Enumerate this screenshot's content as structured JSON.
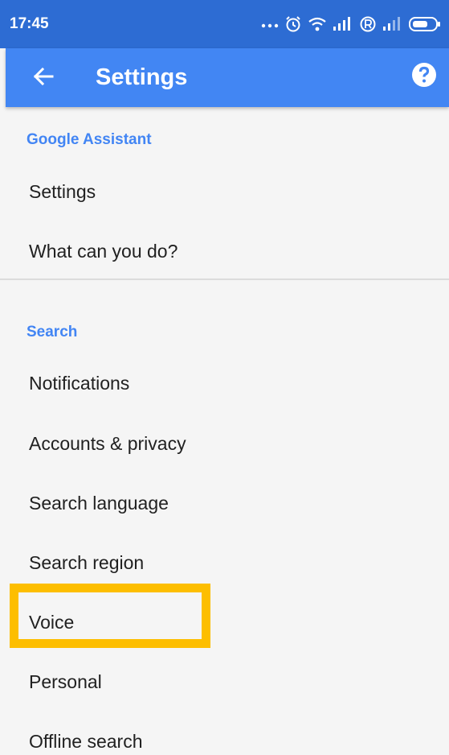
{
  "status_bar": {
    "time": "17:45",
    "icons": [
      "more-dots-icon",
      "alarm-icon",
      "wifi-icon",
      "signal-icon",
      "roaming-r-icon",
      "signal-icon",
      "battery-icon"
    ]
  },
  "app_bar": {
    "title": "Settings",
    "back_icon": "arrow-back-icon",
    "help_icon": "help-icon"
  },
  "sections": [
    {
      "header": "Google Assistant",
      "items": [
        "Settings",
        "What can you do?"
      ]
    },
    {
      "header": "Search",
      "items": [
        "Notifications",
        "Accounts & privacy",
        "Search language",
        "Search region",
        "Voice",
        "Personal",
        "Offline search"
      ]
    }
  ],
  "highlighted_item": "Voice",
  "colors": {
    "status_bar": "#2d6cd3",
    "app_bar": "#4286f3",
    "section_header": "#4285f4",
    "highlight": "#fdbe00",
    "background": "#f5f5f5"
  }
}
